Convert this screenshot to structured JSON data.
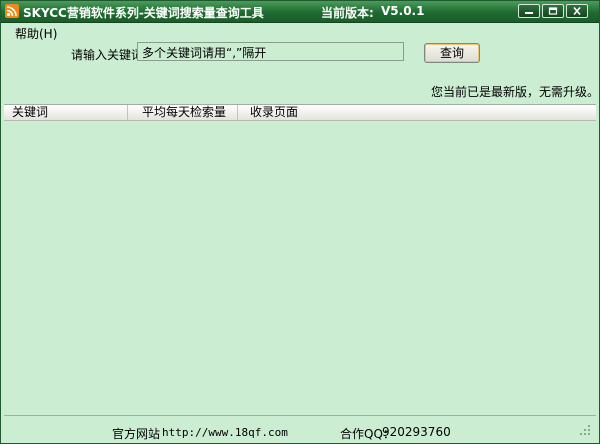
{
  "window": {
    "title": "SKYCC营销软件系列-关键词搜索量查询工具",
    "version_label": "当前版本:",
    "version_value": "V5.0.1",
    "icon": "rss-icon",
    "controls": [
      "minimize-icon",
      "maximize-icon",
      "close-icon"
    ]
  },
  "menu": {
    "help": "帮助(H)"
  },
  "search": {
    "label": "请输入关键词",
    "value": "多个关键词请用“,”隔开",
    "button": "查询"
  },
  "status": "您当前已是最新版，无需升级。",
  "table": {
    "columns": [
      "关键词",
      "平均每天检索量",
      "收录页面"
    ],
    "rows": []
  },
  "footer": {
    "site_label": "官方网站",
    "site_url": "http://www.18qf.com",
    "qq_label": "合作QQ：",
    "qq_value": "920293760"
  },
  "colors": {
    "titlebar": "#1e6a2f",
    "background": "#cbeed3",
    "icon": "#ef8a1a"
  }
}
